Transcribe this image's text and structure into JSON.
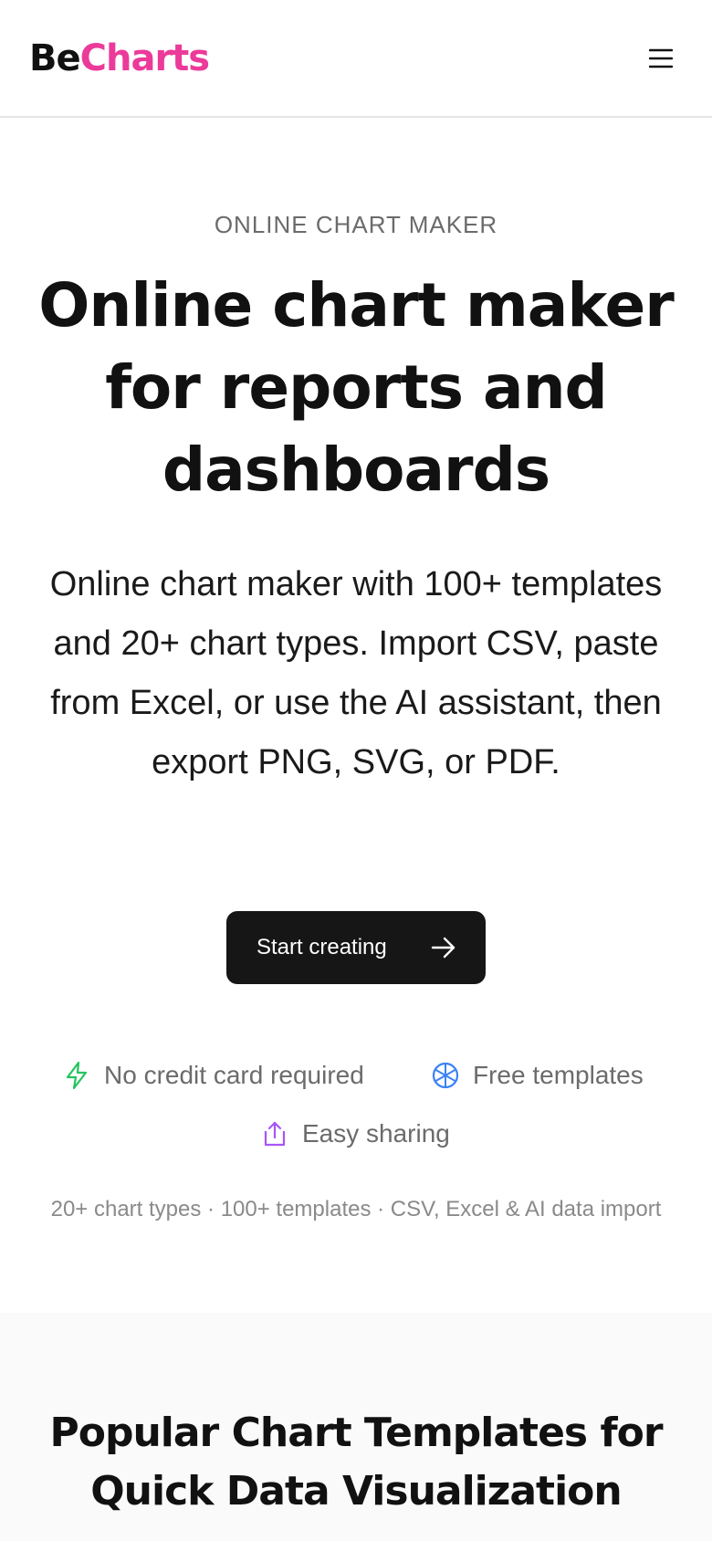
{
  "header": {
    "logo_part1": "Be",
    "logo_part2": "Charts",
    "menu_icon": "menu-icon"
  },
  "hero": {
    "eyebrow": "ONLINE CHART MAKER",
    "title": "Online chart maker for reports and dashboards",
    "description": "Online chart maker with 100+ templates and 20+ chart types. Import CSV, paste from Excel, or use the AI assistant, then export PNG, SVG, or PDF.",
    "cta_label": "Start creating"
  },
  "features": [
    {
      "label": "No credit card required",
      "icon": "lightning-icon",
      "color": "#22c55e"
    },
    {
      "label": "Free templates",
      "icon": "aperture-icon",
      "color": "#3b82f6"
    },
    {
      "label": "Easy sharing",
      "icon": "share-icon",
      "color": "#a855f7"
    }
  ],
  "stats_line": "20+ chart types · 100+ templates · CSV, Excel & AI data import",
  "templates_section": {
    "title": "Popular Chart Templates for Quick Data Visualization"
  },
  "colors": {
    "brand_pink": "#ec3a9a",
    "cta_bg": "#161616"
  }
}
